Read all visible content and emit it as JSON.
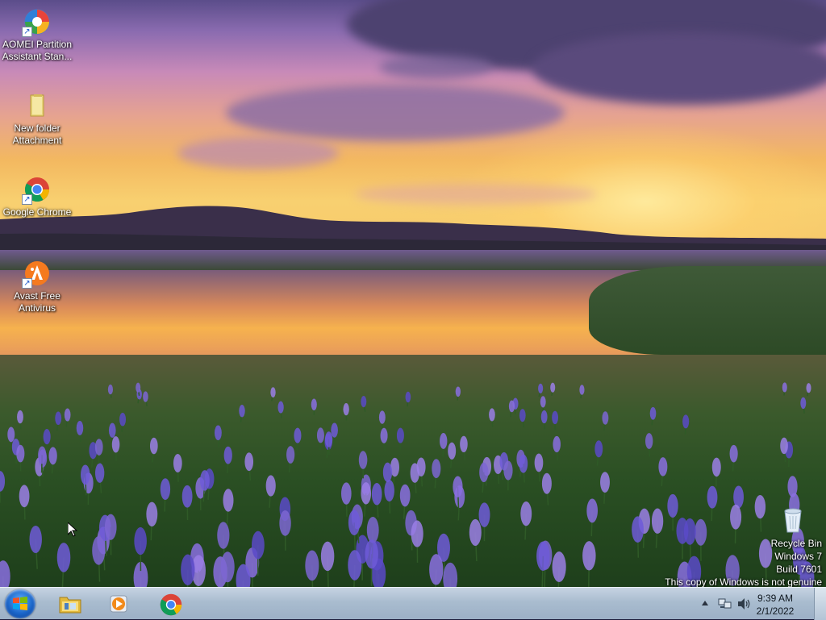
{
  "desktop": {
    "icons": [
      {
        "label": "AOMEI Partition Assistant Stan...",
        "icon": "aomei-partition-icon"
      },
      {
        "label": "New folder Attachment",
        "icon": "folder-icon"
      },
      {
        "label": "Google Chrome",
        "icon": "chrome-icon"
      },
      {
        "label": "Avast Free Antivirus",
        "icon": "avast-icon"
      }
    ],
    "recycle_bin": {
      "label": "Recycle Bin",
      "icon": "recycle-bin-icon"
    }
  },
  "watermark": {
    "line1": "Windows 7",
    "line2": "Build 7601",
    "line3": "This copy of Windows is not genuine"
  },
  "taskbar": {
    "start_icon": "windows-start-icon",
    "pinned": [
      {
        "name": "Windows Explorer",
        "icon": "explorer-icon"
      },
      {
        "name": "Windows Media Player",
        "icon": "media-player-icon"
      },
      {
        "name": "Google Chrome",
        "icon": "chrome-icon"
      }
    ],
    "tray": {
      "icons": [
        "show-hidden-icons-arrow",
        "network-icon",
        "volume-icon"
      ],
      "time": "9:39 AM",
      "date": "2/1/2022"
    }
  },
  "colors": {
    "taskbar": "#a9bccf",
    "label_text": "#ffffff"
  }
}
